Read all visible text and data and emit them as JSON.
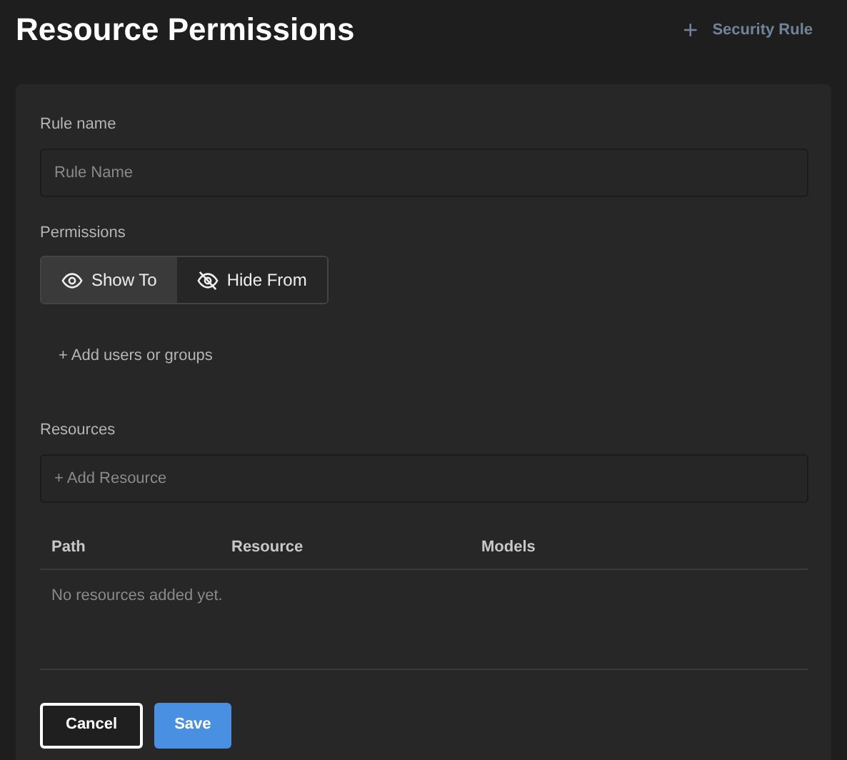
{
  "title": "Resource Permissions",
  "header_action": {
    "icon": "+",
    "label": "Security Rule"
  },
  "rule_name": {
    "label": "Rule name",
    "placeholder": "Rule Name"
  },
  "permissions": {
    "label": "Permissions",
    "options": [
      {
        "label": "Show To",
        "kind": "show",
        "selected": true
      },
      {
        "label": "Hide From",
        "kind": "hide",
        "selected": false
      }
    ],
    "add_link": "+ Add users or groups"
  },
  "resources": {
    "label": "Resources",
    "placeholder": "+ Add Resource",
    "columns": [
      "Path",
      "Resource",
      "Models"
    ],
    "empty_text": "No resources added yet."
  },
  "buttons": [
    {
      "label": "Cancel",
      "kind": "secondary"
    },
    {
      "label": "Save",
      "kind": "primary"
    }
  ]
}
